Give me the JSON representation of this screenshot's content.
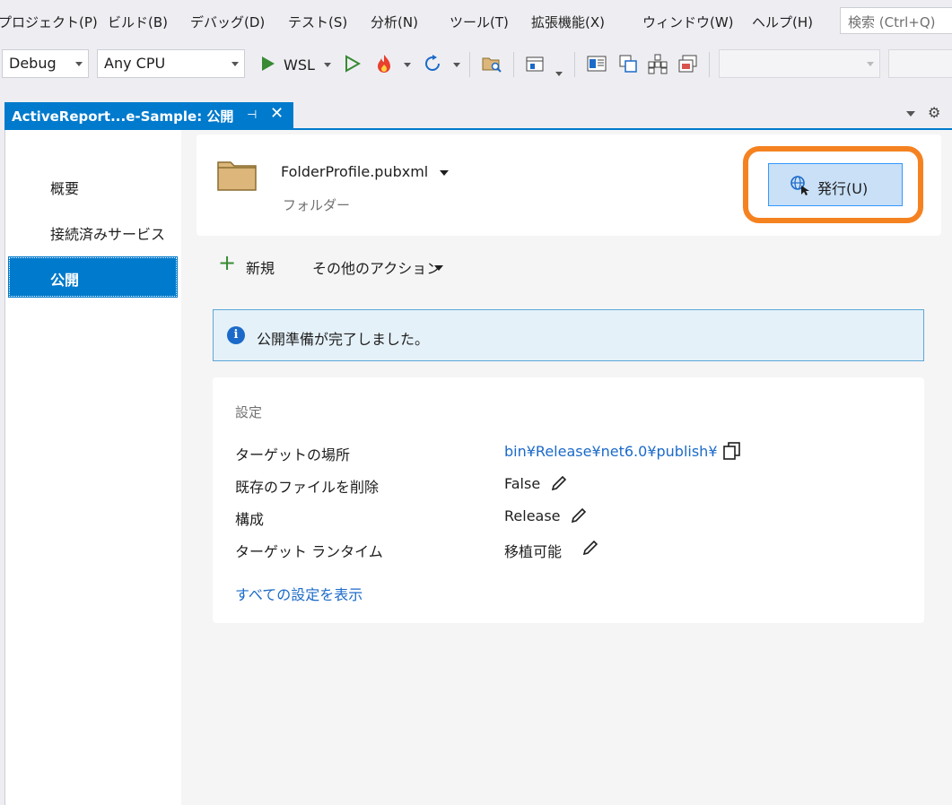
{
  "menu": {
    "items": [
      "プロジェクト(P)",
      "ビルド(B)",
      "デバッグ(D)",
      "テスト(S)",
      "分析(N)",
      "ツール(T)",
      "拡張機能(X)",
      "ウィンドウ(W)",
      "ヘルプ(H)"
    ],
    "search_placeholder": "検索 (Ctrl+Q)"
  },
  "toolbar": {
    "configuration": "Debug",
    "platform": "Any CPU",
    "run_target": "WSL"
  },
  "document_tab": {
    "title": "ActiveReport...e-Sample: 公開",
    "pin_glyph": "⊣",
    "close_glyph": "✕"
  },
  "nav": {
    "items": [
      "概要",
      "接続済みサービス",
      "公開"
    ],
    "selected": "公開"
  },
  "profile": {
    "name": "FolderProfile.pubxml",
    "type": "フォルダー",
    "publish_button": "発行(U)"
  },
  "actions": {
    "new": "新規",
    "other": "その他のアクション"
  },
  "info": {
    "message": "公開準備が完了しました。"
  },
  "settings": {
    "title": "設定",
    "rows": [
      {
        "label": "ターゲットの場所",
        "value": "bin¥Release¥net6.0¥publish¥"
      },
      {
        "label": "既存のファイルを削除",
        "value": "False"
      },
      {
        "label": "構成",
        "value": "Release"
      },
      {
        "label": "ターゲット ランタイム",
        "value": "移植可能"
      }
    ],
    "show_all": "すべての設定を表示"
  },
  "colors": {
    "accent": "#007acc",
    "highlight": "#f58220",
    "link": "#1b6ac9",
    "run_green": "#388a34"
  }
}
